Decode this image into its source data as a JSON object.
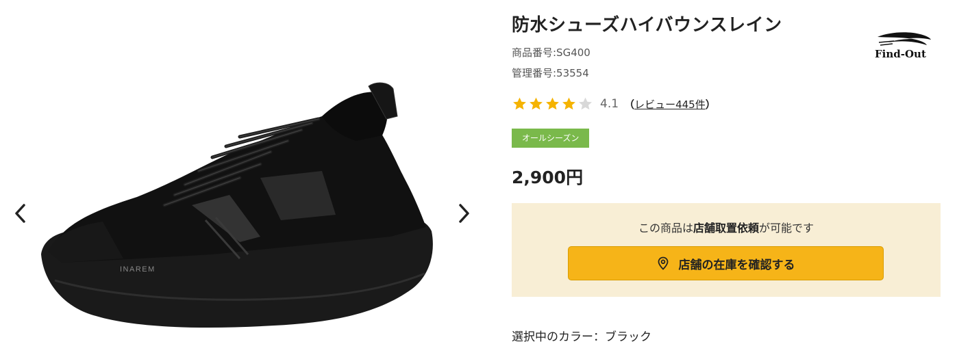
{
  "colors": {
    "accent_yellow": "#f6b418",
    "store_box_bg": "#f8eed5",
    "season_tag_bg": "#7ab94b",
    "star_filled": "#f5b301",
    "star_empty": "#d8d8d8"
  },
  "gallery": {
    "prev_icon": "chevron-left-icon",
    "next_icon": "chevron-right-icon",
    "image_icon": "sneaker-image",
    "shoe_text": "INAREM"
  },
  "product": {
    "title": "防水シューズハイバウンスレイン",
    "product_number": "商品番号:SG400",
    "management_number": "管理番号:53554",
    "brand": "Find-Out",
    "rating": {
      "stars_filled": 4,
      "stars_total": 5,
      "value": "4.1",
      "review_prefix": "（",
      "review_link": "レビュー445件",
      "review_suffix": "）"
    },
    "season_tag": "オールシーズン",
    "price": "2,900円"
  },
  "store": {
    "message_pre": "この商品は",
    "message_bold": "店舗取置依頼",
    "message_post": "が可能です",
    "button_icon": "map-pin-icon",
    "button_label": "店舗の在庫を確認する"
  },
  "color_selection": {
    "label": "選択中のカラー：ブラック"
  }
}
